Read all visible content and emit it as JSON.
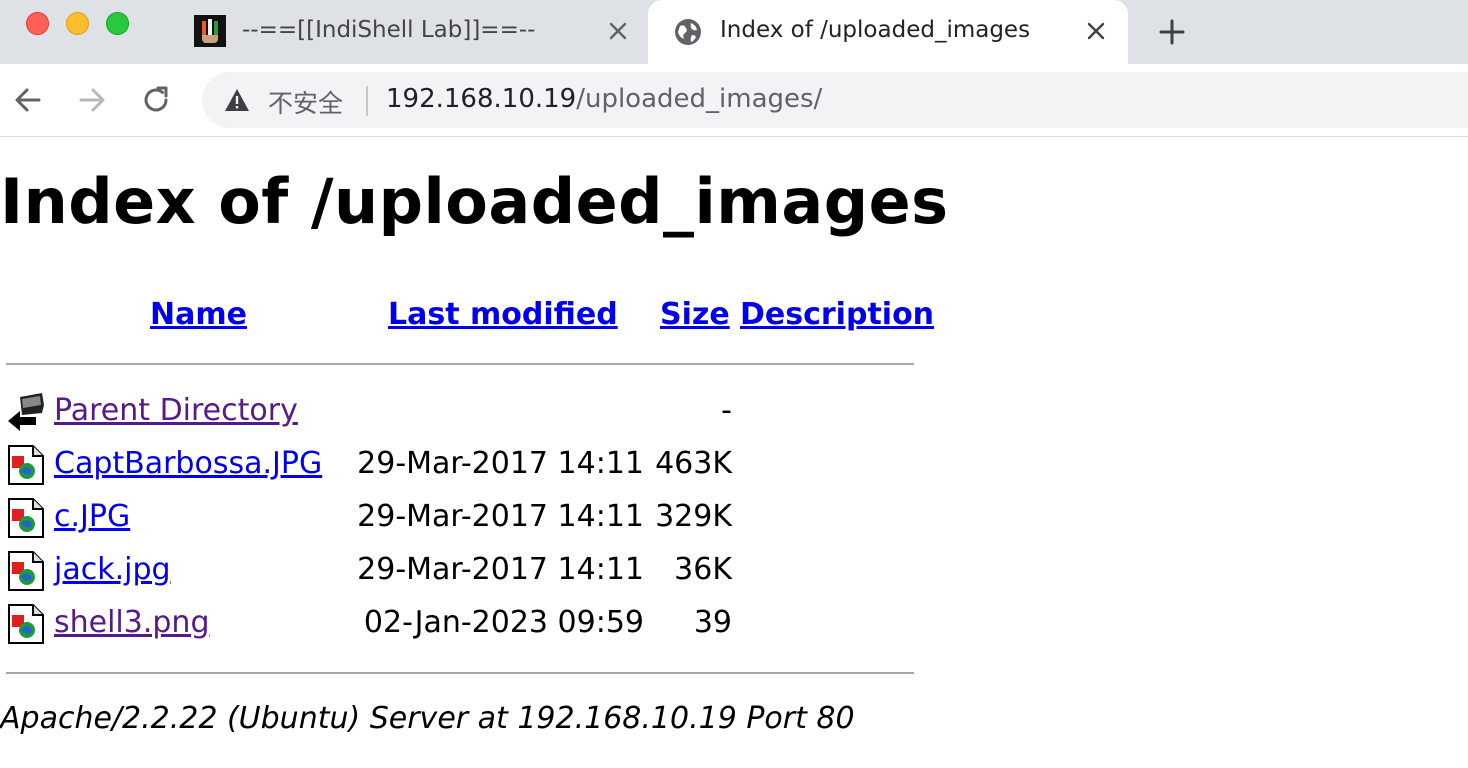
{
  "browser": {
    "tabs": [
      {
        "title": "--==[[IndiShell Lab]]==--",
        "favicon": "indishell-logo-icon",
        "active": false
      },
      {
        "title": "Index of /uploaded_images",
        "favicon": "globe-icon",
        "active": true
      }
    ],
    "new_tab_icon": "plus-icon",
    "nav": {
      "back_icon": "back-arrow-icon",
      "forward_icon": "forward-arrow-icon",
      "reload_icon": "reload-icon"
    },
    "address_bar": {
      "security_icon": "warning-triangle-icon",
      "security_label": "不安全",
      "url_host": "192.168.10.19",
      "url_path": "/uploaded_images/"
    }
  },
  "page": {
    "heading": "Index of /uploaded_images",
    "columns": {
      "name": "Name",
      "last_modified": "Last modified",
      "size": "Size",
      "description": "Description"
    },
    "entries": [
      {
        "icon": "back-folder-icon",
        "name": "Parent Directory",
        "modified": "",
        "size": "-",
        "visited": true
      },
      {
        "icon": "image-file-icon",
        "name": "CaptBarbossa.JPG",
        "modified": "29-Mar-2017 14:11",
        "size": "463K",
        "visited": false
      },
      {
        "icon": "image-file-icon",
        "name": "c.JPG",
        "modified": "29-Mar-2017 14:11",
        "size": "329K",
        "visited": false
      },
      {
        "icon": "image-file-icon",
        "name": "jack.jpg",
        "modified": "29-Mar-2017 14:11",
        "size": "36K",
        "visited": false
      },
      {
        "icon": "image-file-icon",
        "name": "shell3.png",
        "modified": "02-Jan-2023 09:59",
        "size": "39",
        "visited": true
      }
    ],
    "footer": "Apache/2.2.22 (Ubuntu) Server at 192.168.10.19 Port 80"
  },
  "colors": {
    "link": "#0000ee",
    "visited_link": "#551a8b",
    "tabstrip": "#dee1e6",
    "omnibox": "#f1f3f4"
  }
}
